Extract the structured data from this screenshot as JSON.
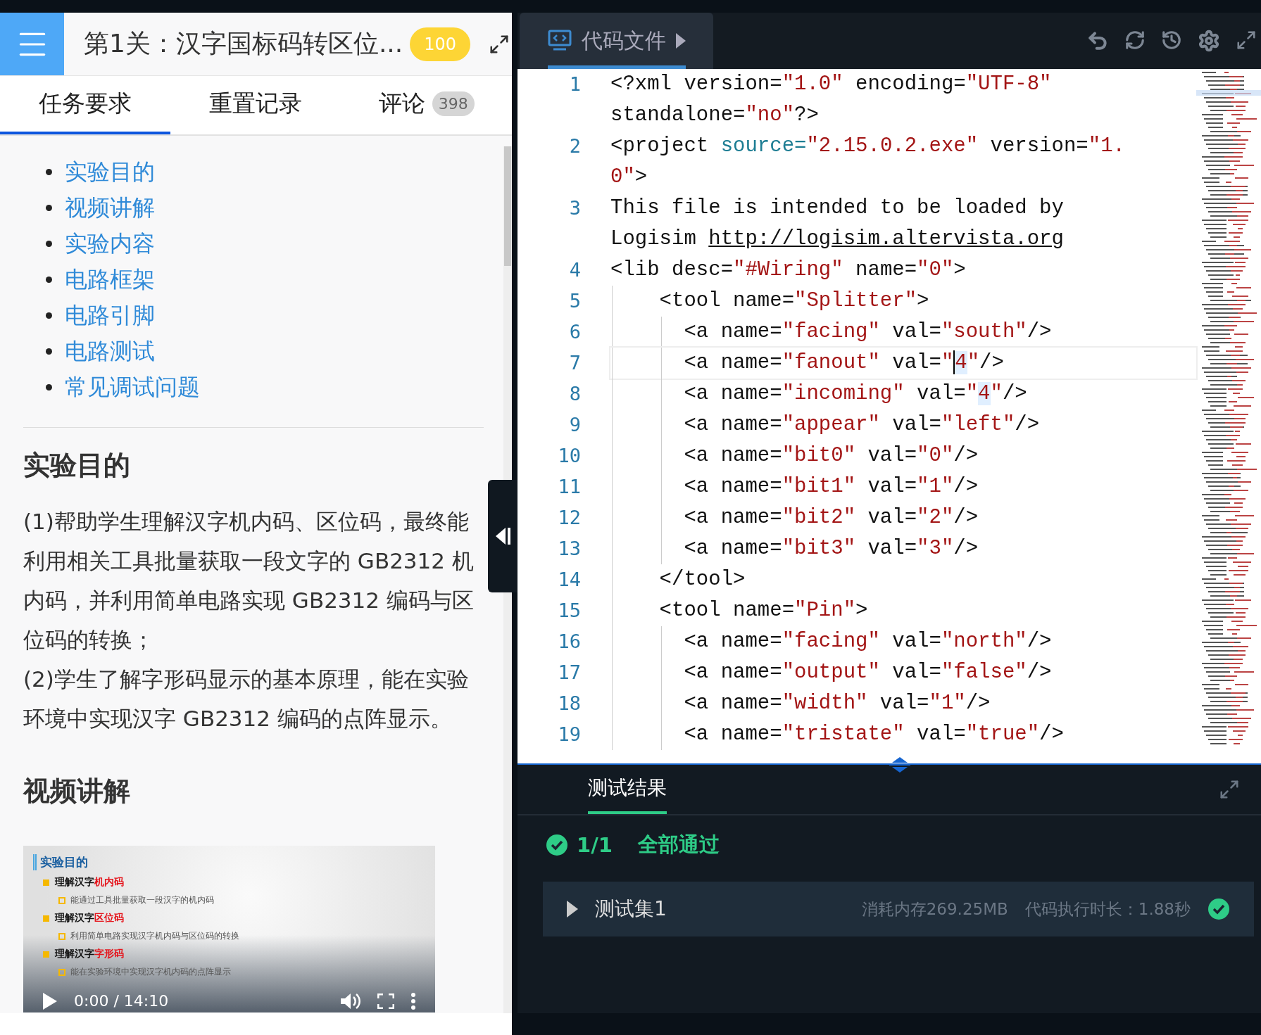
{
  "header": {
    "title": "第1关：汉字国标码转区位...",
    "score": "100"
  },
  "tabs": [
    {
      "label": "任务要求",
      "selected": true
    },
    {
      "label": "重置记录",
      "selected": false
    },
    {
      "label": "评论",
      "count": "398",
      "selected": false
    }
  ],
  "toc": [
    "实验目的",
    "视频讲解",
    "实验内容",
    "电路框架",
    "电路引脚",
    "电路测试",
    "常见调试问题"
  ],
  "sections": [
    {
      "heading": "实验目的",
      "paragraphs": [
        "(1)帮助学生理解汉字机内码、区位码，最终能利用相关工具批量获取一段文字的 GB2312 机内码，并利用简单电路实现 GB2312 编码与区位码的转换；",
        "(2)学生了解字形码显示的基本原理，能在实验环境中实现汉字 GB2312 编码的点阵显示。"
      ]
    },
    {
      "heading": "视频讲解",
      "video": {
        "slide_title": "实验目的",
        "bullets": [
          {
            "label": "理解汉字",
            "highlight": "机内码",
            "note": "能通过工具批量获取一段汉字的机内码"
          },
          {
            "label": "理解汉字",
            "highlight": "区位码",
            "note": "利用简单电路实现汉字机内码与区位码的转换"
          },
          {
            "label": "理解汉字",
            "highlight": "字形码",
            "note": "能在实验环境中实现汉字机内码的点阵显示"
          }
        ],
        "time": "0:00 / 14:10"
      }
    }
  ],
  "editor": {
    "tab": "代码文件",
    "lines": [
      {
        "number": "1",
        "current": false,
        "tokens": [
          {
            "kind": "plain",
            "text": "<?xml version="
          },
          {
            "kind": "string",
            "text": "\"1.0\""
          },
          {
            "kind": "plain",
            "text": " encoding="
          },
          {
            "kind": "string",
            "text": "\"UTF-8\""
          },
          {
            "kind": "wrap"
          },
          {
            "kind": "plain",
            "text": "standalone="
          },
          {
            "kind": "string",
            "text": "\"no\""
          },
          {
            "kind": "plain",
            "text": "?>"
          }
        ]
      },
      {
        "number": "2",
        "current": false,
        "tokens": [
          {
            "kind": "plain",
            "text": "<project "
          },
          {
            "kind": "attr",
            "text": "source="
          },
          {
            "kind": "string",
            "text": "\"2.15.0.2.exe\""
          },
          {
            "kind": "plain",
            "text": " version="
          },
          {
            "kind": "string",
            "text": "\"1."
          },
          {
            "kind": "wrap"
          },
          {
            "kind": "string",
            "text": "0\""
          },
          {
            "kind": "plain",
            "text": ">"
          }
        ]
      },
      {
        "number": "3",
        "current": false,
        "tokens": [
          {
            "kind": "plain",
            "text": "This file is intended to be loaded by"
          },
          {
            "kind": "wrap"
          },
          {
            "kind": "plain",
            "text": "Logisim "
          },
          {
            "kind": "link",
            "text": "http://logisim.altervista.org"
          }
        ]
      },
      {
        "number": "4",
        "current": false,
        "tokens": [
          {
            "kind": "plain",
            "text": "<lib desc="
          },
          {
            "kind": "string",
            "text": "\"#Wiring\""
          },
          {
            "kind": "plain",
            "text": " name="
          },
          {
            "kind": "string",
            "text": "\"0\""
          },
          {
            "kind": "plain",
            "text": ">"
          }
        ]
      },
      {
        "number": "5",
        "current": false,
        "tokens": [
          {
            "kind": "plain",
            "text": "    <tool name="
          },
          {
            "kind": "string",
            "text": "\"Splitter\""
          },
          {
            "kind": "plain",
            "text": ">"
          }
        ]
      },
      {
        "number": "6",
        "current": false,
        "tokens": [
          {
            "kind": "plain",
            "text": "      <a name="
          },
          {
            "kind": "string",
            "text": "\"facing\""
          },
          {
            "kind": "plain",
            "text": " val="
          },
          {
            "kind": "string",
            "text": "\"south\""
          },
          {
            "kind": "plain",
            "text": "/>"
          }
        ]
      },
      {
        "number": "7",
        "current": true,
        "tokens": [
          {
            "kind": "plain",
            "text": "      <a name="
          },
          {
            "kind": "string",
            "text": "\"fanout\""
          },
          {
            "kind": "plain",
            "text": " val="
          },
          {
            "kind": "string",
            "text": "\""
          },
          {
            "kind": "caret"
          },
          {
            "kind": "match",
            "text": "4"
          },
          {
            "kind": "string",
            "text": "\""
          },
          {
            "kind": "plain",
            "text": "/>"
          }
        ]
      },
      {
        "number": "8",
        "current": false,
        "tokens": [
          {
            "kind": "plain",
            "text": "      <a name="
          },
          {
            "kind": "string",
            "text": "\"incoming\""
          },
          {
            "kind": "plain",
            "text": " val="
          },
          {
            "kind": "string",
            "text": "\""
          },
          {
            "kind": "match",
            "text": "4"
          },
          {
            "kind": "string",
            "text": "\""
          },
          {
            "kind": "plain",
            "text": "/>"
          }
        ]
      },
      {
        "number": "9",
        "current": false,
        "tokens": [
          {
            "kind": "plain",
            "text": "      <a name="
          },
          {
            "kind": "string",
            "text": "\"appear\""
          },
          {
            "kind": "plain",
            "text": " val="
          },
          {
            "kind": "string",
            "text": "\"left\""
          },
          {
            "kind": "plain",
            "text": "/>"
          }
        ]
      },
      {
        "number": "10",
        "current": false,
        "tokens": [
          {
            "kind": "plain",
            "text": "      <a name="
          },
          {
            "kind": "string",
            "text": "\"bit0\""
          },
          {
            "kind": "plain",
            "text": " val="
          },
          {
            "kind": "string",
            "text": "\"0\""
          },
          {
            "kind": "plain",
            "text": "/>"
          }
        ]
      },
      {
        "number": "11",
        "current": false,
        "tokens": [
          {
            "kind": "plain",
            "text": "      <a name="
          },
          {
            "kind": "string",
            "text": "\"bit1\""
          },
          {
            "kind": "plain",
            "text": " val="
          },
          {
            "kind": "string",
            "text": "\"1\""
          },
          {
            "kind": "plain",
            "text": "/>"
          }
        ]
      },
      {
        "number": "12",
        "current": false,
        "tokens": [
          {
            "kind": "plain",
            "text": "      <a name="
          },
          {
            "kind": "string",
            "text": "\"bit2\""
          },
          {
            "kind": "plain",
            "text": " val="
          },
          {
            "kind": "string",
            "text": "\"2\""
          },
          {
            "kind": "plain",
            "text": "/>"
          }
        ]
      },
      {
        "number": "13",
        "current": false,
        "tokens": [
          {
            "kind": "plain",
            "text": "      <a name="
          },
          {
            "kind": "string",
            "text": "\"bit3\""
          },
          {
            "kind": "plain",
            "text": " val="
          },
          {
            "kind": "string",
            "text": "\"3\""
          },
          {
            "kind": "plain",
            "text": "/>"
          }
        ]
      },
      {
        "number": "14",
        "current": false,
        "tokens": [
          {
            "kind": "plain",
            "text": "    </tool>"
          }
        ]
      },
      {
        "number": "15",
        "current": false,
        "tokens": [
          {
            "kind": "plain",
            "text": "    <tool name="
          },
          {
            "kind": "string",
            "text": "\"Pin\""
          },
          {
            "kind": "plain",
            "text": ">"
          }
        ]
      },
      {
        "number": "16",
        "current": false,
        "tokens": [
          {
            "kind": "plain",
            "text": "      <a name="
          },
          {
            "kind": "string",
            "text": "\"facing\""
          },
          {
            "kind": "plain",
            "text": " val="
          },
          {
            "kind": "string",
            "text": "\"north\""
          },
          {
            "kind": "plain",
            "text": "/>"
          }
        ]
      },
      {
        "number": "17",
        "current": false,
        "tokens": [
          {
            "kind": "plain",
            "text": "      <a name="
          },
          {
            "kind": "string",
            "text": "\"output\""
          },
          {
            "kind": "plain",
            "text": " val="
          },
          {
            "kind": "string",
            "text": "\"false\""
          },
          {
            "kind": "plain",
            "text": "/>"
          }
        ]
      },
      {
        "number": "18",
        "current": false,
        "tokens": [
          {
            "kind": "plain",
            "text": "      <a name="
          },
          {
            "kind": "string",
            "text": "\"width\""
          },
          {
            "kind": "plain",
            "text": " val="
          },
          {
            "kind": "string",
            "text": "\"1\""
          },
          {
            "kind": "plain",
            "text": "/>"
          }
        ]
      },
      {
        "number": "19",
        "current": false,
        "tokens": [
          {
            "kind": "plain",
            "text": "      <a name="
          },
          {
            "kind": "string",
            "text": "\"tristate\""
          },
          {
            "kind": "plain",
            "text": " val="
          },
          {
            "kind": "string",
            "text": "\"true\""
          },
          {
            "kind": "plain",
            "text": "/>"
          }
        ]
      }
    ]
  },
  "results": {
    "tab": "测试结果",
    "count": "1/1",
    "summary": "全部通过",
    "passed": true,
    "sets": [
      {
        "name": "测试集1",
        "memory": "消耗内存269.25MB",
        "duration": "代码执行时长：1.88秒",
        "passed": true
      }
    ]
  }
}
